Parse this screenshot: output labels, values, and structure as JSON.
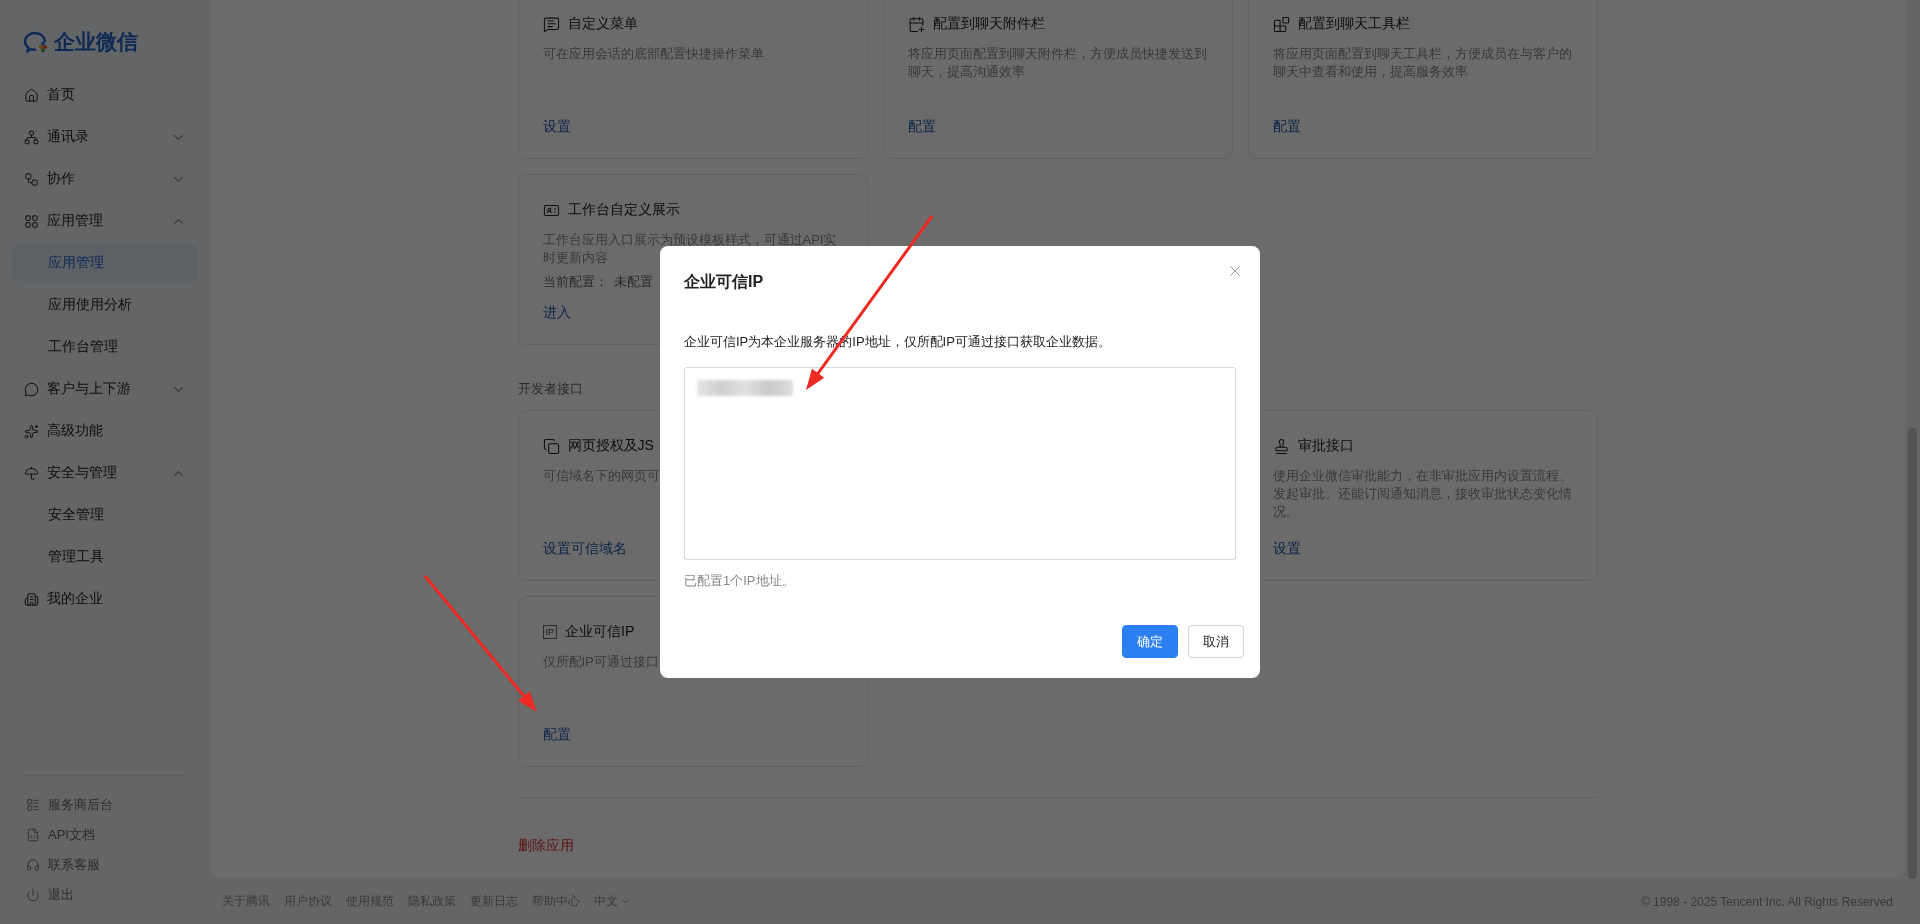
{
  "logo": {
    "text": "企业微信"
  },
  "nav": [
    {
      "label": "首页"
    },
    {
      "label": "通讯录",
      "expanded": false
    },
    {
      "label": "协作",
      "expanded": false
    },
    {
      "label": "应用管理",
      "expanded": true,
      "children": [
        {
          "label": "应用管理",
          "selected": true
        },
        {
          "label": "应用使用分析",
          "selected": false
        },
        {
          "label": "工作台管理",
          "selected": false
        }
      ]
    },
    {
      "label": "客户与上下游",
      "expanded": false
    },
    {
      "label": "高级功能"
    },
    {
      "label": "安全与管理",
      "expanded": true,
      "children": [
        {
          "label": "安全管理",
          "selected": false
        },
        {
          "label": "管理工具",
          "selected": false
        }
      ]
    },
    {
      "label": "我的企业"
    }
  ],
  "sidebar_footer": [
    "服务商后台",
    "API文档",
    "联系客服",
    "退出"
  ],
  "sections": [
    {
      "cards": [
        {
          "title": "自定义菜单",
          "description": "可在应用会话的底部配置快捷操作菜单",
          "link": "设置"
        },
        {
          "title": "配置到聊天附件栏",
          "description": "将应用页面配置到聊天附件栏，方便成员快捷发送到聊天，提高沟通效率",
          "link": "配置"
        },
        {
          "title": "配置到聊天工具栏",
          "description": "将应用页面配置到聊天工具栏，方便成员在与客户的聊天中查看和使用，提高服务效率",
          "link": "配置"
        },
        {
          "title": "工作台自定义展示",
          "description": "工作台应用入口展示为预设模板样式，可通过API实时更新内容",
          "status_label": "当前配置：",
          "status_value": "未配置",
          "link": "进入"
        }
      ]
    },
    {
      "title": "开发者接口",
      "cards": [
        {
          "title": "网页授权及JS",
          "description": "可信域名下的网页可",
          "link": "设置可信域名"
        },
        {
          "title": "审批接口",
          "description": "使用企业微信审批能力，在非审批应用内设置流程、发起审批。还能订阅通知消息，接收审批状态变化情况。",
          "link": "设置"
        },
        {
          "title": "企业可信IP",
          "icon_text": "IP",
          "description": "仅所配IP可通过接口",
          "link": "配置"
        }
      ]
    }
  ],
  "delete_link": "删除应用",
  "footer": {
    "links": [
      "关于腾讯",
      "用户协议",
      "使用规范",
      "隐私政策",
      "更新日志",
      "帮助中心"
    ],
    "language": "中文",
    "copyright": "© 1998 - 2025 Tencent Inc. All Rights Reserved"
  },
  "modal": {
    "title": "企业可信IP",
    "description": "企业可信IP为本企业服务器的IP地址，仅所配IP可通过接口获取企业数据。",
    "hint": "已配置1个IP地址。",
    "buttons": [
      {
        "label": "确定",
        "kind": "primary"
      },
      {
        "label": "取消",
        "kind": "secondary"
      }
    ]
  }
}
